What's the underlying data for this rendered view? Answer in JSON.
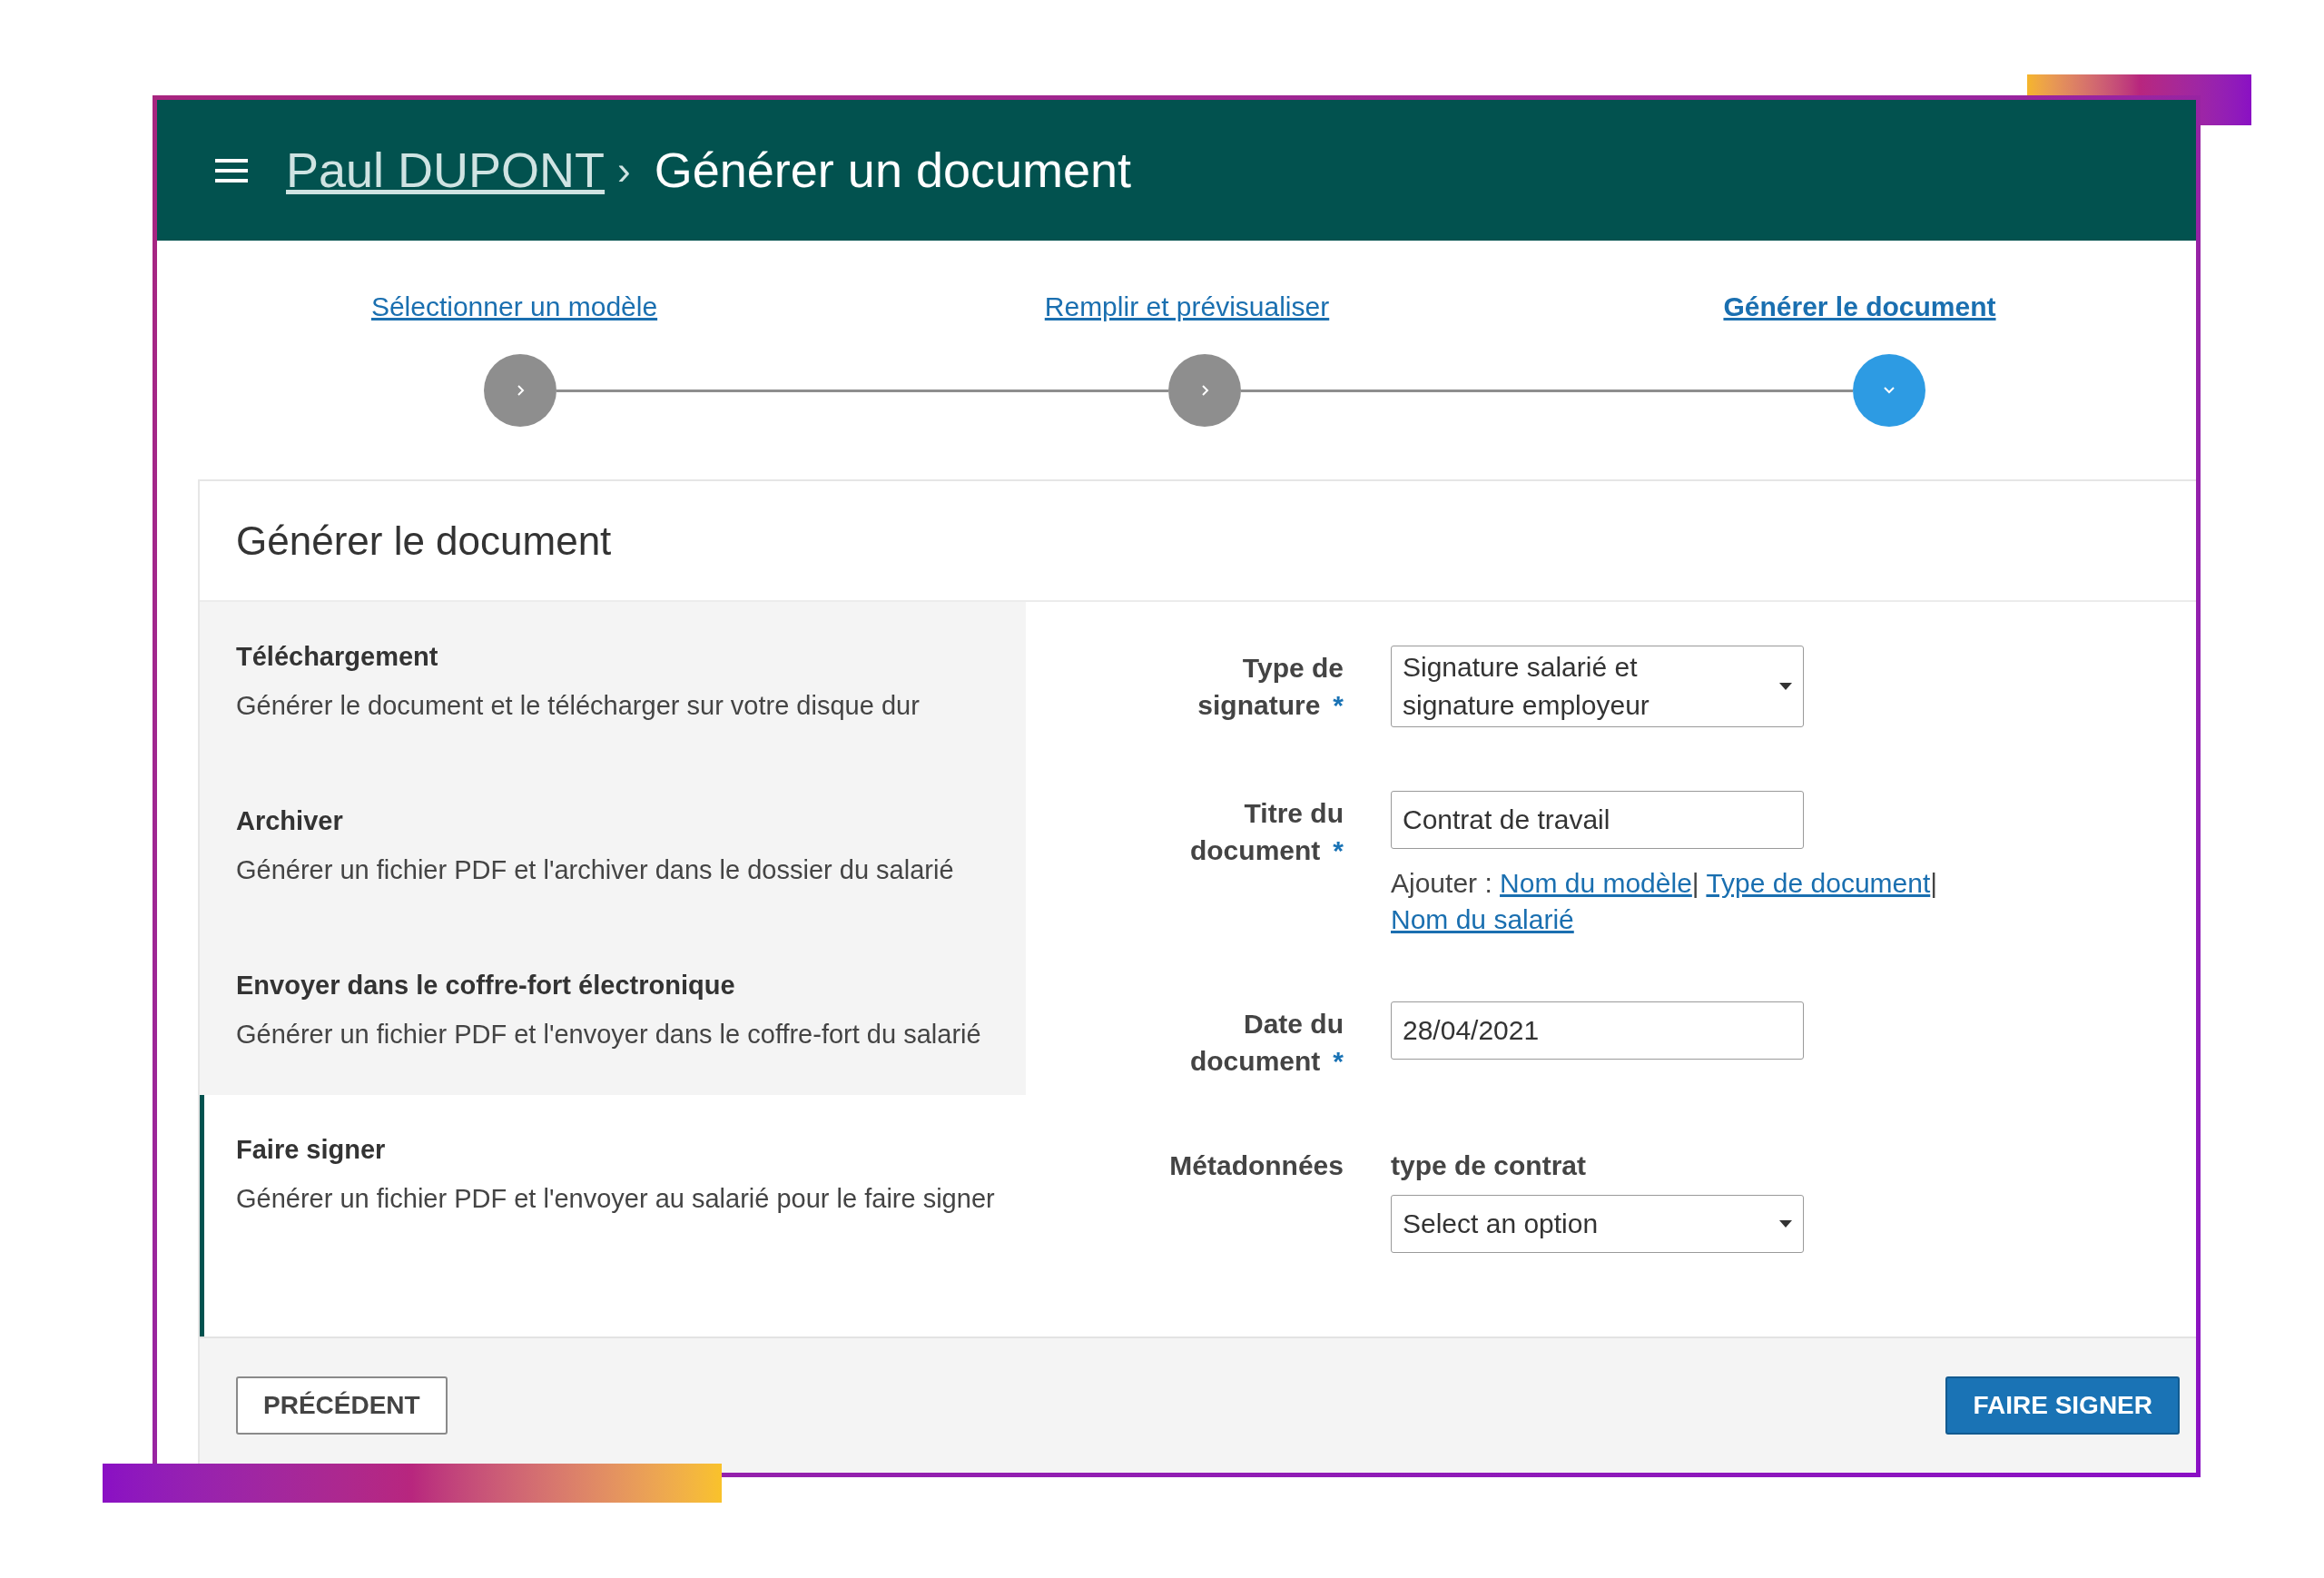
{
  "header": {
    "breadcrumb_link": "Paul DUPONT",
    "separator": "›",
    "title": "Générer un document"
  },
  "stepper": {
    "steps": [
      {
        "label": "Sélectionner un modèle",
        "selected": false
      },
      {
        "label": "Remplir et prévisualiser",
        "selected": false
      },
      {
        "label": "Générer le document",
        "selected": true
      }
    ]
  },
  "card": {
    "title": "Générer le document",
    "options": [
      {
        "title": "Téléchargement",
        "description": "Générer le document et le télécharger sur votre disque dur",
        "selected": false
      },
      {
        "title": "Archiver",
        "description": "Générer un fichier PDF et l'archiver dans le dossier du salarié",
        "selected": false
      },
      {
        "title": "Envoyer dans le coffre-fort électronique",
        "description": "Générer un fichier PDF et l'envoyer dans le coffre-fort du salarié",
        "selected": false
      },
      {
        "title": "Faire signer",
        "description": "Générer un fichier PDF et l'envoyer au salarié pour le faire signer",
        "selected": true
      }
    ],
    "form": {
      "fields": [
        {
          "kind": "select",
          "label": "Type de signature",
          "required": true,
          "value": "Signature salarié et signature employeur"
        },
        {
          "kind": "text",
          "label": "Titre du document",
          "required": true,
          "value": "Contrat de travail",
          "insert": {
            "prefix": "Ajouter :",
            "links": [
              "Nom du modèle",
              "Type de document",
              "Nom du salarié"
            ],
            "separator": "|"
          }
        },
        {
          "kind": "text",
          "label": "Date du document",
          "required": true,
          "value": "28/04/2021"
        },
        {
          "kind": "metadata",
          "label": "Métadonnées",
          "sublabel": "type de contrat",
          "value": "Select an option"
        }
      ],
      "required_mark": "*"
    }
  },
  "footer": {
    "back_button": "PRÉCÉDENT",
    "submit_button": "FAIRE SIGNER"
  }
}
